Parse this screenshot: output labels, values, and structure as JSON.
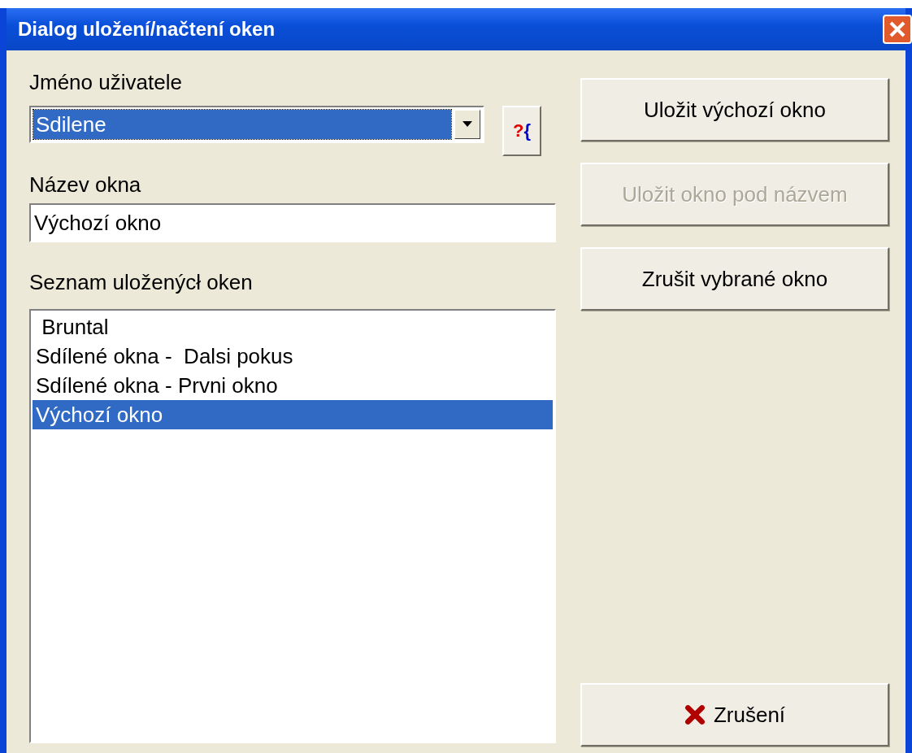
{
  "window": {
    "title": "Dialog uložení/načtení oken"
  },
  "user": {
    "label": "Jméno uživatele",
    "value": "Sdilene"
  },
  "help_button": {
    "label": "?{"
  },
  "name_field": {
    "label": "Název okna",
    "value": "Výchozí okno"
  },
  "saved_list": {
    "label": "Seznam uloženýcł oken",
    "items": [
      {
        "text": " Bruntal",
        "selected": false
      },
      {
        "text": "Sdílené okna -  Dalsi pokus",
        "selected": false
      },
      {
        "text": "Sdílené okna - Prvni okno",
        "selected": false
      },
      {
        "text": "Výchozí okno",
        "selected": true
      }
    ]
  },
  "buttons": [
    {
      "label": "Uložit výchozí okno",
      "disabled": false
    },
    {
      "label": "Uložit okno pod názvem",
      "disabled": true
    },
    {
      "label": "Zrušit vybrané okno",
      "disabled": false
    }
  ],
  "cancel_button": {
    "label": "Zrušení"
  }
}
